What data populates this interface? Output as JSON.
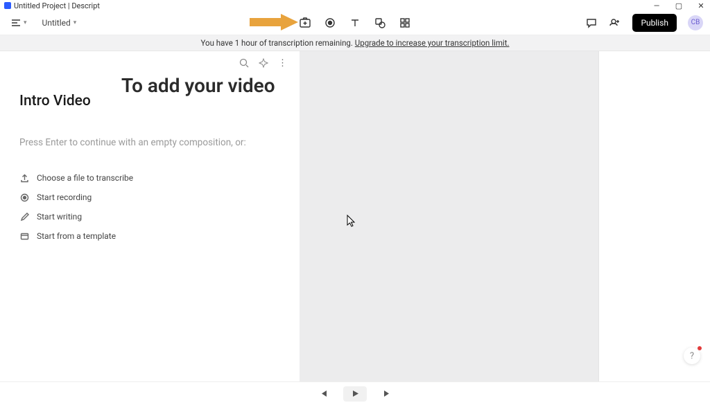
{
  "window": {
    "title": "Untitled Project | Descript"
  },
  "toolbar": {
    "project_name": "Untitled",
    "publish_label": "Publish",
    "avatar_initials": "CB"
  },
  "banner": {
    "text": "You have 1 hour of transcription remaining. ",
    "link": "Upgrade to increase your transcription limit."
  },
  "overlay": {
    "heading": "To add your video"
  },
  "panel": {
    "title": "Intro Video",
    "hint": "Press Enter to continue with an empty composition, or:",
    "options": [
      {
        "label": "Choose a file to transcribe",
        "icon": "upload"
      },
      {
        "label": "Start recording",
        "icon": "record"
      },
      {
        "label": "Start writing",
        "icon": "pencil"
      },
      {
        "label": "Start from a template",
        "icon": "template"
      }
    ]
  },
  "help": {
    "glyph": "?"
  }
}
